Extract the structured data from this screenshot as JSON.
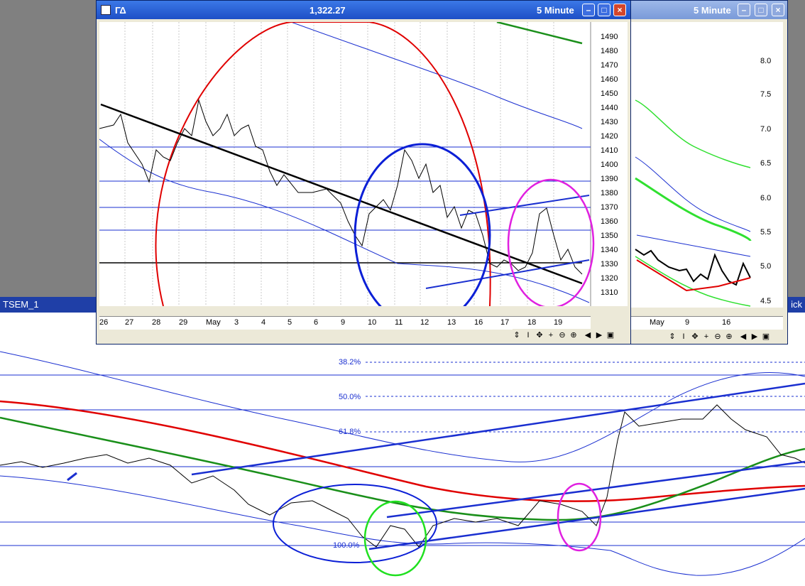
{
  "main_window": {
    "title": "ΓΔ",
    "price": "1,322.27",
    "interval": "5 Minute",
    "y_ticks": [
      "1490",
      "1480",
      "1470",
      "1460",
      "1450",
      "1440",
      "1430",
      "1420",
      "1410",
      "1400",
      "1390",
      "1380",
      "1370",
      "1360",
      "1350",
      "1340",
      "1330",
      "1320",
      "1310"
    ],
    "x_ticks": [
      "26",
      "27",
      "28",
      "29",
      "May",
      "3",
      "4",
      "5",
      "6",
      "9",
      "10",
      "11",
      "12",
      "13",
      "16",
      "17",
      "18",
      "19"
    ]
  },
  "second_window": {
    "interval": "5 Minute",
    "y_ticks": [
      "8.0",
      "7.5",
      "7.0",
      "6.5",
      "6.0",
      "5.5",
      "5.0",
      "4.5"
    ],
    "x_ticks": [
      "May",
      "9",
      "16"
    ]
  },
  "background": {
    "label": "TSEM_1",
    "label_right": "ick",
    "fib_levels": [
      "38.2%",
      "50.0%",
      "61.8%",
      "100.0%"
    ]
  },
  "colors": {
    "title_active": "#1d4fc6",
    "red_circle": "#e00000",
    "blue_circle": "#0b1fd6",
    "magenta_circle": "#e020e0",
    "green_circle": "#20e020",
    "trend_black": "#000000"
  },
  "icons": [
    "app-icon",
    "minimize-icon",
    "maximize-icon",
    "close-icon",
    "scroll-left-icon",
    "scroll-right-icon",
    "zoom-in-icon",
    "zoom-out-icon"
  ]
}
